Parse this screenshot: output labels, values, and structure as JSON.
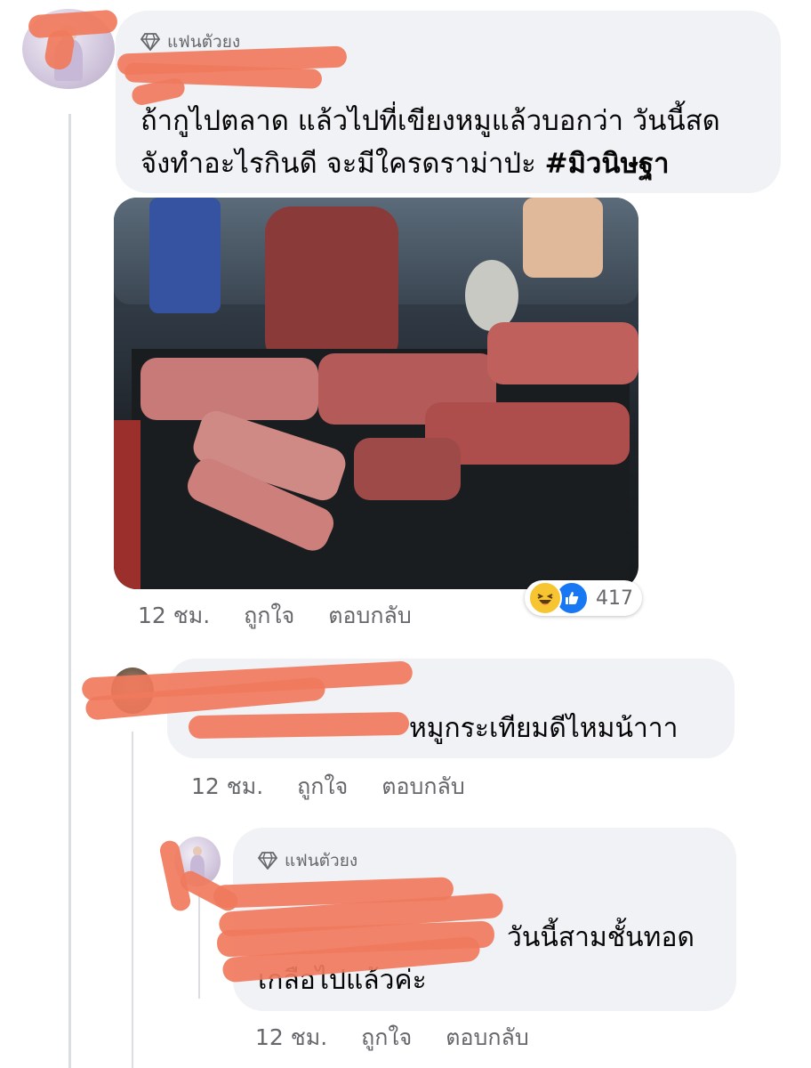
{
  "comments": [
    {
      "badge": "แฟนตัวยง",
      "text_line1": "ถ้ากูไปตลาด แล้วไปที่เขียงหมูแล้วบอกว่า วันนี้สด",
      "text_line2": "จังทำอะไรกินดี  จะมีใครดราม่าป่ะ ",
      "hashtag": "#มิวนิษฐา",
      "time": "12 ชม.",
      "like_label": "ถูกใจ",
      "reply_label": "ตอบกลับ",
      "reactions": {
        "icons": [
          "haha-icon",
          "like-icon"
        ],
        "count": "417"
      }
    },
    {
      "text_line1": "หมูกระเทียมดีไหมน้าาา",
      "time": "12 ชม.",
      "like_label": "ถูกใจ",
      "reply_label": "ตอบกลับ"
    },
    {
      "badge": "แฟนตัวยง",
      "text_line1": "วันนี้สามชั้นทอด",
      "text_line2": "เกลือไปแล้วค่ะ",
      "time": "12 ชม.",
      "like_label": "ถูกใจ",
      "reply_label": "ตอบกลับ"
    }
  ],
  "colors": {
    "bubble": "#f0f2f5",
    "meta_text": "#65676b",
    "redaction": "#f07a5c",
    "like_blue": "#1877f2",
    "haha_yellow": "#f7c531"
  }
}
